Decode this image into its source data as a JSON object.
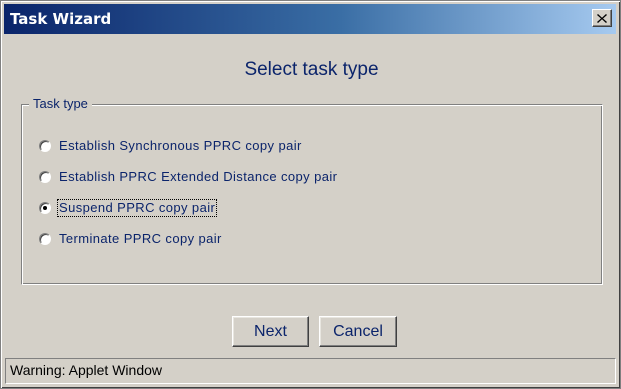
{
  "window": {
    "title": "Task Wizard",
    "close_glyph": "×"
  },
  "heading": "Select task type",
  "task_type_group": {
    "legend": "Task type",
    "options": [
      {
        "label": "Establish Synchronous PPRC copy pair",
        "selected": false
      },
      {
        "label": "Establish PPRC Extended Distance copy pair",
        "selected": false
      },
      {
        "label": "Suspend PPRC copy pair",
        "selected": true
      },
      {
        "label": "Terminate PPRC copy pair",
        "selected": false
      }
    ]
  },
  "buttons": {
    "next_label": "Next",
    "cancel_label": "Cancel"
  },
  "status_bar": {
    "text": "Warning: Applet Window"
  }
}
